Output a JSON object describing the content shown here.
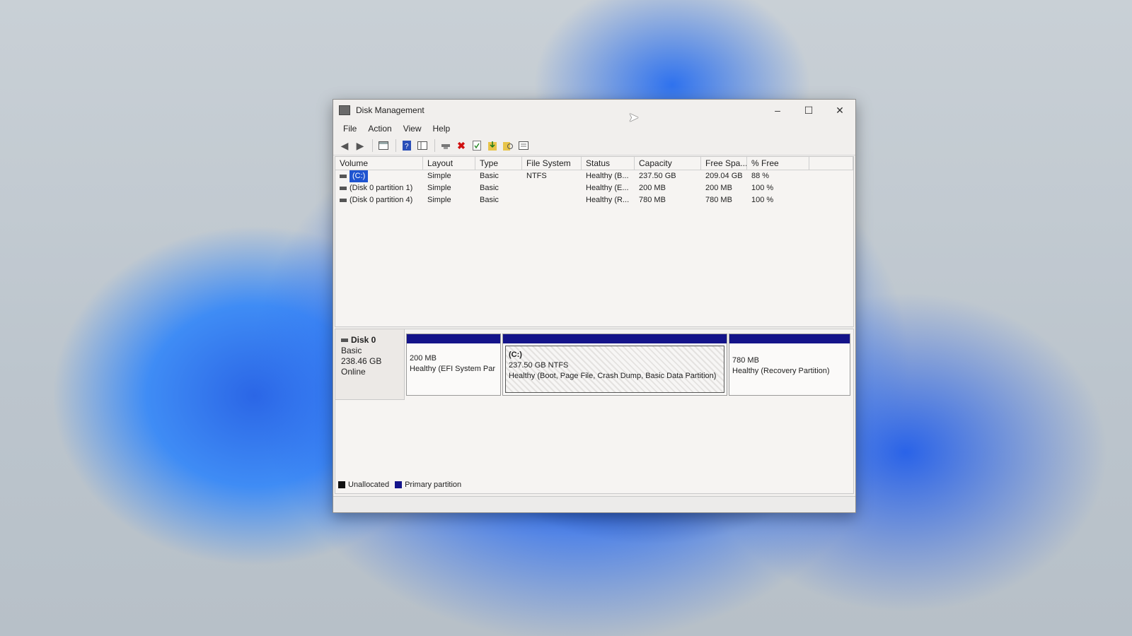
{
  "window": {
    "title": "Disk Management",
    "controls": {
      "minimize": "–",
      "maximize": "☐",
      "close": "✕"
    }
  },
  "menu": [
    "File",
    "Action",
    "View",
    "Help"
  ],
  "toolbar_icons": [
    "back-icon",
    "forward-icon",
    "console-tree-icon",
    "help-icon",
    "view-icon",
    "connect-icon",
    "delete-icon",
    "check-icon",
    "import-icon",
    "rescan-icon",
    "properties-icon"
  ],
  "volumes": {
    "headers": [
      "Volume",
      "Layout",
      "Type",
      "File System",
      "Status",
      "Capacity",
      "Free Spa...",
      "% Free"
    ],
    "rows": [
      {
        "volume": "(C:)",
        "layout": "Simple",
        "type": "Basic",
        "fs": "NTFS",
        "status": "Healthy (B...",
        "capacity": "237.50 GB",
        "free": "209.04 GB",
        "pct": "88 %"
      },
      {
        "volume": "(Disk 0 partition 1)",
        "layout": "Simple",
        "type": "Basic",
        "fs": "",
        "status": "Healthy (E...",
        "capacity": "200 MB",
        "free": "200 MB",
        "pct": "100 %"
      },
      {
        "volume": "(Disk 0 partition 4)",
        "layout": "Simple",
        "type": "Basic",
        "fs": "",
        "status": "Healthy (R...",
        "capacity": "780 MB",
        "free": "780 MB",
        "pct": "100 %"
      }
    ]
  },
  "disk": {
    "name": "Disk 0",
    "type": "Basic",
    "size": "238.46 GB",
    "state": "Online",
    "partitions": [
      {
        "label": "",
        "size": "200 MB",
        "status": "Healthy (EFI System Par"
      },
      {
        "label": "(C:)",
        "size": "237.50 GB NTFS",
        "status": "Healthy (Boot, Page File, Crash Dump, Basic Data Partition)"
      },
      {
        "label": "",
        "size": "780 MB",
        "status": "Healthy (Recovery Partition)"
      }
    ]
  },
  "legend": [
    {
      "label": "Unallocated",
      "color": "#111111"
    },
    {
      "label": "Primary partition",
      "color": "#14148a"
    }
  ]
}
